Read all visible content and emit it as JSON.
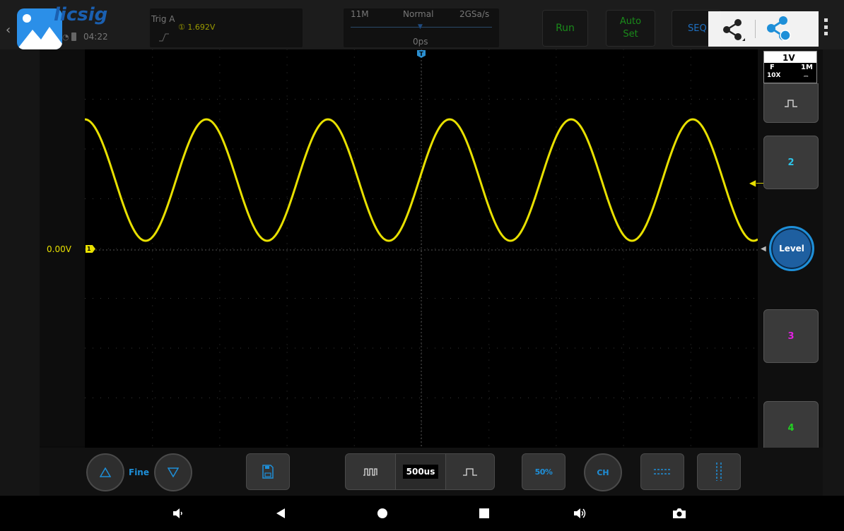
{
  "header": {
    "brand": "licsig",
    "time": "04:22",
    "trigger": {
      "label": "Trig",
      "mode": "A",
      "level": "1.692V",
      "channel_symbol": "①"
    },
    "timebase": {
      "depth": "11M",
      "acq_mode": "Normal",
      "sample_rate": "2GSa/s",
      "position": "0ps"
    },
    "buttons": {
      "run": "Run",
      "auto": "Auto",
      "set": "Set",
      "seq": "SEQ"
    }
  },
  "channel1_info": {
    "scale": "1V",
    "coupling": "F",
    "impedance": "1M",
    "probe": "10X"
  },
  "side": {
    "ch2": "2",
    "level": "Level",
    "ch3": "3",
    "ch4": "4"
  },
  "waveform": {
    "ground_label": "0.00V",
    "marker": "1",
    "trigger_marker": "T",
    "color": "#e8e000"
  },
  "toolbar": {
    "fine": "Fine",
    "timebase": "500us",
    "fifty": "50%",
    "ch": "CH"
  },
  "colors": {
    "accent": "#1e8fd8",
    "ch1": "#e8e000",
    "ch2": "#2ec4e8",
    "ch3": "#e020e0",
    "ch4": "#22d022",
    "run": "#1a8a1a"
  }
}
